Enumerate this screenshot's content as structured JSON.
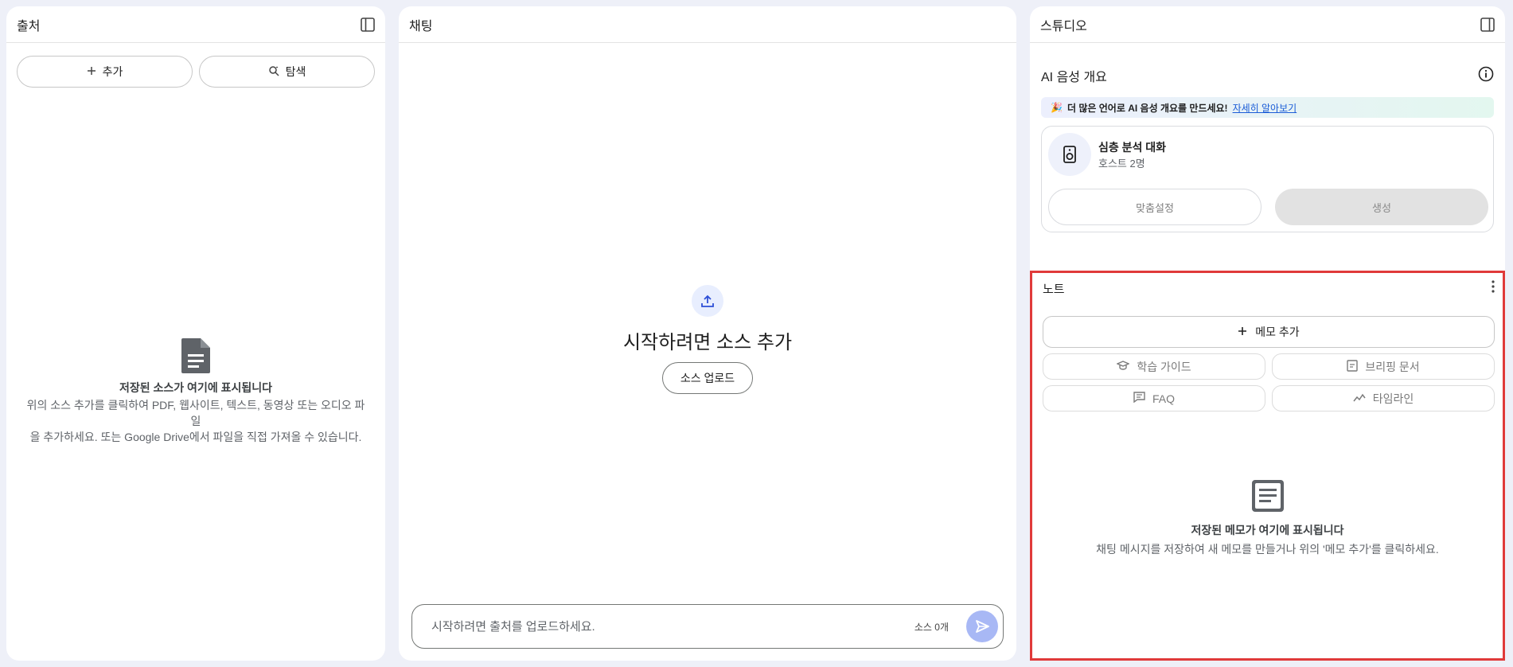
{
  "sources": {
    "title": "출처",
    "add_label": "추가",
    "explore_label": "탐색",
    "empty_title": "저장된 소스가 여기에 표시됩니다",
    "empty_line1": "위의 소스 추가를 클릭하여 PDF, 웹사이트, 텍스트, 동영상 또는 오디오 파일",
    "empty_line2": "을 추가하세요. 또는 Google Drive에서 파일을 직접 가져올 수 있습니다."
  },
  "chat": {
    "title": "채팅",
    "heading": "시작하려면 소스 추가",
    "upload_label": "소스 업로드",
    "input_placeholder": "시작하려면 출처를 업로드하세요.",
    "source_count": "소스 0개"
  },
  "studio": {
    "title": "스튜디오",
    "audio_title": "AI 음성 개요",
    "banner_text": "더 많은 언어로 AI 음성 개요를 만드세요!",
    "banner_link": "자세히 알아보기",
    "card_title": "심층 분석 대화",
    "card_sub": "호스트 2명",
    "customize_label": "맞춤설정",
    "generate_label": "생성"
  },
  "notes": {
    "title": "노트",
    "add_memo": "메모 추가",
    "study_guide": "학습 가이드",
    "briefing": "브리핑 문서",
    "faq": "FAQ",
    "timeline": "타임라인",
    "empty_title": "저장된 메모가 여기에 표시됩니다",
    "empty_desc": "채팅 메시지를 저장하여 새 메모를 만들거나 위의 '메모 추가'를 클릭하세요."
  },
  "colors": {
    "background": "#eef0f8",
    "accent": "#a8b8f5",
    "highlight_border": "#e03a3a"
  }
}
